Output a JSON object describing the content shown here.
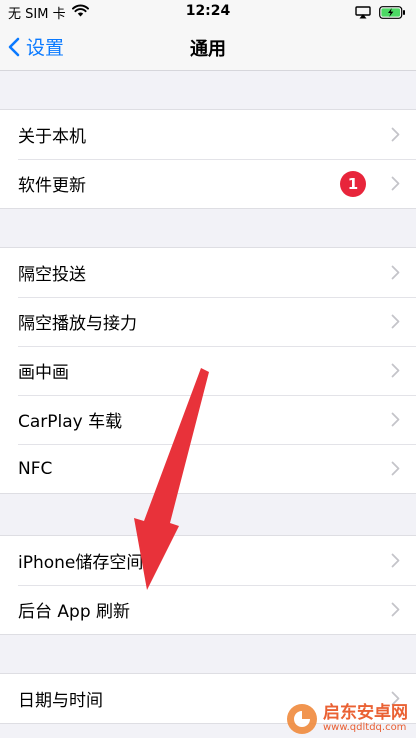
{
  "status_bar": {
    "carrier": "无 SIM 卡",
    "time": "12:24"
  },
  "nav": {
    "back_label": "设置",
    "title": "通用"
  },
  "groups": [
    {
      "items": [
        {
          "label": "关于本机"
        },
        {
          "label": "软件更新",
          "badge": "1"
        }
      ]
    },
    {
      "items": [
        {
          "label": "隔空投送"
        },
        {
          "label": "隔空播放与接力"
        },
        {
          "label": "画中画"
        },
        {
          "label": "CarPlay 车载"
        },
        {
          "label": "NFC"
        }
      ]
    },
    {
      "items": [
        {
          "label": "iPhone储存空间"
        },
        {
          "label": "后台 App 刷新"
        }
      ]
    },
    {
      "items": [
        {
          "label": "日期与时间"
        }
      ]
    }
  ],
  "watermark": {
    "name": "启东安卓网",
    "url": "www.qdltdq.com"
  },
  "colors": {
    "accent": "#0a7aff",
    "badge": "#e8253b",
    "arrow": "#e8323a",
    "background": "#f2f2f7"
  }
}
